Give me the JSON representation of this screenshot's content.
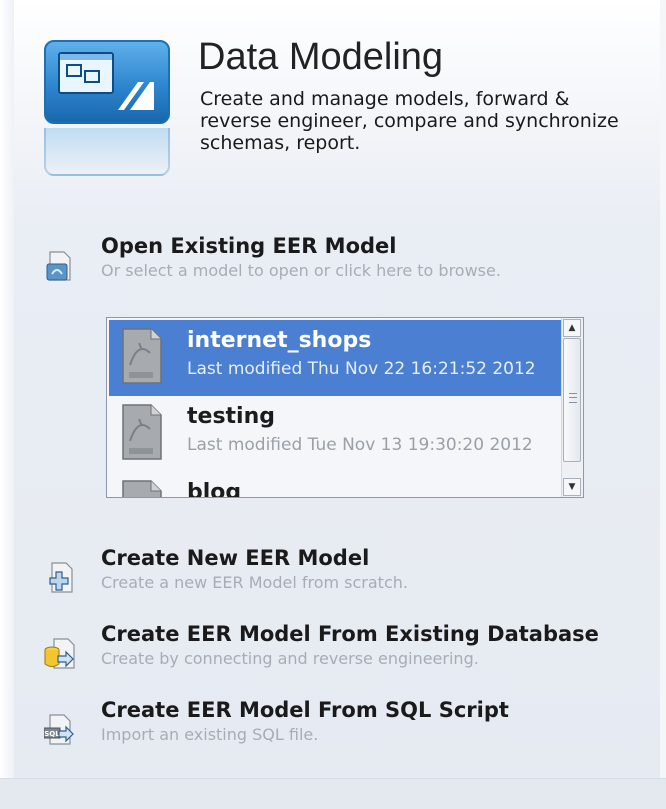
{
  "header": {
    "title": "Data Modeling",
    "description": "Create and manage models, forward & reverse engineer, compare and synchronize schemas, report."
  },
  "open_model": {
    "title": "Open Existing EER Model",
    "subtitle": "Or select a model to open or click here to browse."
  },
  "models": [
    {
      "name": "internet_shops",
      "modified": "Last modified Thu Nov 22 16:21:52 2012",
      "selected": true
    },
    {
      "name": "testing",
      "modified": "Last modified Tue Nov 13 19:30:20 2012",
      "selected": false
    },
    {
      "name": "blog",
      "modified": "",
      "selected": false
    }
  ],
  "actions": [
    {
      "title": "Create New EER Model",
      "subtitle": "Create a new EER Model from scratch."
    },
    {
      "title": "Create EER Model From Existing Database",
      "subtitle": "Create by connecting and reverse engineering."
    },
    {
      "title": "Create EER Model From SQL Script",
      "subtitle": "Import an existing SQL file."
    }
  ],
  "colors": {
    "selection": "#4a7fd2",
    "icon_blue": "#2e86cf",
    "subtitle_gray": "#a8adb5"
  },
  "icons": {
    "hero": "data-modeling-icon",
    "open": "open-model-icon",
    "model_file": "mwb-file-icon",
    "new": "new-model-icon",
    "from_db": "reverse-engineer-icon",
    "from_sql": "sql-script-icon"
  }
}
